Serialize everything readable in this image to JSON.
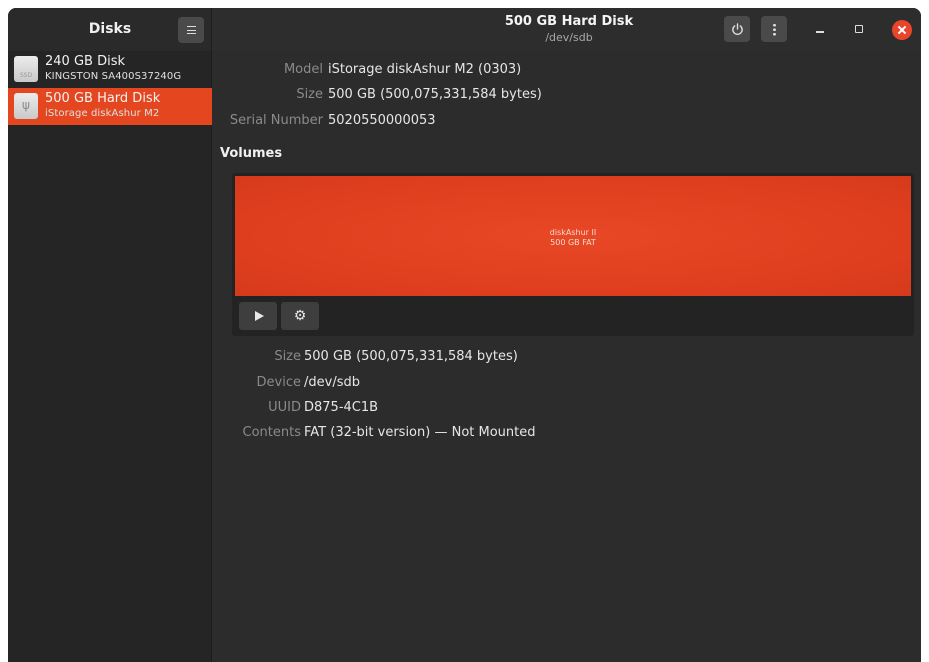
{
  "sidebar": {
    "title": "Disks",
    "disks": [
      {
        "name": "240 GB Disk",
        "model": "KINGSTON SA400S37240G",
        "icon": "ssd-disk-icon",
        "icon_label": "SSD",
        "selected": false
      },
      {
        "name": "500 GB Hard Disk",
        "model": "iStorage diskAshur M2",
        "icon": "usb-drive-icon",
        "selected": true
      }
    ]
  },
  "header": {
    "title": "500 GB Hard Disk",
    "subtitle": "/dev/sdb",
    "icons": [
      "menu-icon",
      "power-icon",
      "kebab-menu-icon",
      "minimize-icon",
      "maximize-icon",
      "close-icon"
    ]
  },
  "drive": {
    "model_label": "Model",
    "model_value": "iStorage diskAshur M2 (0303)",
    "size_label": "Size",
    "size_value": "500 GB (500,075,331,584 bytes)",
    "serial_label": "Serial Number",
    "serial_value": "5020550000053"
  },
  "volumes": {
    "title": "Volumes",
    "partition": {
      "line1": "diskAshur II",
      "line2": "500 GB FAT"
    },
    "details": {
      "size_label": "Size",
      "size_value": "500 GB (500,075,331,584 bytes)",
      "device_label": "Device",
      "device_value": "/dev/sdb",
      "uuid_label": "UUID",
      "uuid_value": "D875-4C1B",
      "contents_label": "Contents",
      "contents_value": "FAT (32-bit version) — Not Mounted"
    }
  },
  "colors": {
    "accent": "#e4471f",
    "window_bg": "#2c2c2c",
    "sidebar_bg": "#252525",
    "close_button": "#e9452b"
  }
}
